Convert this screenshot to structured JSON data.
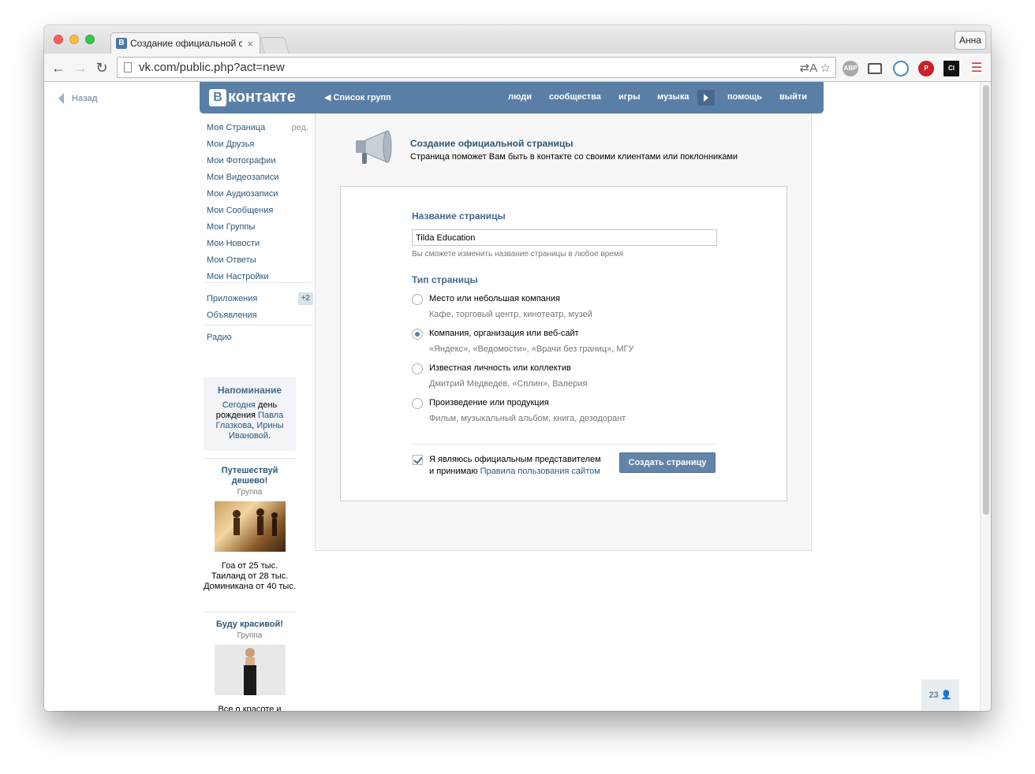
{
  "browser": {
    "tab_title": "Создание официальной ст",
    "tab_close": "×",
    "profile_name": "Анна",
    "url": "vk.com/public.php?act=new",
    "url_tools": "⇄A ☆",
    "favicon_letter": "В"
  },
  "vk": {
    "back": "Назад",
    "logo_letter": "В",
    "logo_text": "контакте",
    "groups_link": "Список групп",
    "nav": [
      "люди",
      "сообщества",
      "игры",
      "музыка",
      "помощь",
      "выйти"
    ],
    "menu": [
      {
        "label": "Моя Страница"
      },
      {
        "label": "Мои Друзья"
      },
      {
        "label": "Мои Фотографии"
      },
      {
        "label": "Мои Видеозаписи"
      },
      {
        "label": "Мои Аудиозаписи"
      },
      {
        "label": "Мои Сообщения"
      },
      {
        "label": "Мои Группы"
      },
      {
        "label": "Мои Новости"
      },
      {
        "label": "Мои Ответы"
      },
      {
        "label": "Мои Настройки"
      },
      {
        "label": "Приложения"
      },
      {
        "label": "Объявления"
      },
      {
        "label": "Радио"
      }
    ],
    "menu_edit": "ред.",
    "apps_badge": "+2",
    "reminder": {
      "title": "Напоминание",
      "text_1": "Сегодня",
      "text_2": " день рождения ",
      "name_1": "Павла Глазкова",
      "text_3": ", ",
      "name_2": "Ирины Ивановой",
      "text_4": "."
    },
    "ads": [
      {
        "title": "Путешествуй дешево!",
        "sub": "Группа",
        "text": "Гоа от 25 тыс. Таиланд от 28 тыс. Доминикана от 40 тыс."
      },
      {
        "title": "Буду красивой!",
        "sub": "Группа",
        "text": "Все о красоте и пластической хирургии"
      }
    ],
    "counter": "23"
  },
  "page": {
    "title": "Создание официальной страницы",
    "subtitle": "Страница поможет Вам быть в контакте со своими клиентами или поклонниками",
    "name_label": "Название страницы",
    "name_value": "Tilda Education",
    "name_hint": "Вы сможете изменить название страницы в любое время",
    "type_label": "Тип страницы",
    "types": [
      {
        "label": "Место или небольшая компания",
        "desc": "Кафе, торговый центр, кинотеатр, музей",
        "checked": false
      },
      {
        "label": "Компания, организация или веб-сайт",
        "desc": "«Яндекс», «Ведомости», «Врачи без границ», МГУ",
        "checked": true
      },
      {
        "label": "Известная личность или коллектив",
        "desc": "Дмитрий Медведев, «Сплин», Валерия",
        "checked": false
      },
      {
        "label": "Произведение или продукция",
        "desc": "Фильм, музыкальный альбом, книга, дезодорант",
        "checked": false
      }
    ],
    "agree_1": "Я являюсь официальным представителем",
    "agree_2": "и принимаю ",
    "agree_link": "Правила пользования сайтом",
    "agree_checked": true,
    "create_button": "Создать страницу"
  },
  "colors": {
    "vk_header": "#5a7fa6",
    "link": "#2b587a",
    "button": "#6383a8"
  }
}
